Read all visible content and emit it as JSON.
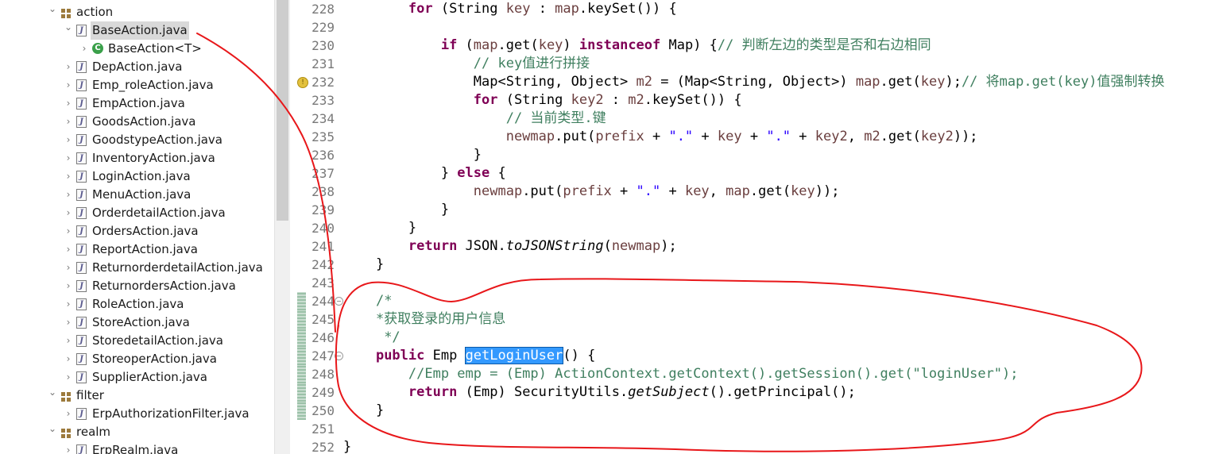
{
  "explorer": {
    "rows": [
      {
        "label": "action",
        "kind": "package",
        "expanded": true,
        "indent": 0
      },
      {
        "label": "BaseAction.java",
        "kind": "java",
        "expanded": true,
        "indent": 1,
        "selected": true
      },
      {
        "label": "BaseAction<T>",
        "kind": "class",
        "expanded": false,
        "indent": 2
      },
      {
        "label": "DepAction.java",
        "kind": "java",
        "expanded": false,
        "indent": 1
      },
      {
        "label": "Emp_roleAction.java",
        "kind": "java",
        "expanded": false,
        "indent": 1
      },
      {
        "label": "EmpAction.java",
        "kind": "java",
        "expanded": false,
        "indent": 1
      },
      {
        "label": "GoodsAction.java",
        "kind": "java",
        "expanded": false,
        "indent": 1
      },
      {
        "label": "GoodstypeAction.java",
        "kind": "java",
        "expanded": false,
        "indent": 1
      },
      {
        "label": "InventoryAction.java",
        "kind": "java",
        "expanded": false,
        "indent": 1
      },
      {
        "label": "LoginAction.java",
        "kind": "java",
        "expanded": false,
        "indent": 1
      },
      {
        "label": "MenuAction.java",
        "kind": "java",
        "expanded": false,
        "indent": 1
      },
      {
        "label": "OrderdetailAction.java",
        "kind": "java",
        "expanded": false,
        "indent": 1
      },
      {
        "label": "OrdersAction.java",
        "kind": "java",
        "expanded": false,
        "indent": 1
      },
      {
        "label": "ReportAction.java",
        "kind": "java",
        "expanded": false,
        "indent": 1
      },
      {
        "label": "ReturnorderdetailAction.java",
        "kind": "java",
        "expanded": false,
        "indent": 1
      },
      {
        "label": "ReturnordersAction.java",
        "kind": "java",
        "expanded": false,
        "indent": 1
      },
      {
        "label": "RoleAction.java",
        "kind": "java",
        "expanded": false,
        "indent": 1
      },
      {
        "label": "StoreAction.java",
        "kind": "java",
        "expanded": false,
        "indent": 1
      },
      {
        "label": "StoredetailAction.java",
        "kind": "java",
        "expanded": false,
        "indent": 1
      },
      {
        "label": "StoreoperAction.java",
        "kind": "java",
        "expanded": false,
        "indent": 1
      },
      {
        "label": "SupplierAction.java",
        "kind": "java",
        "expanded": false,
        "indent": 1
      },
      {
        "label": "filter",
        "kind": "package",
        "expanded": true,
        "indent": 0
      },
      {
        "label": "ErpAuthorizationFilter.java",
        "kind": "java",
        "expanded": false,
        "indent": 1
      },
      {
        "label": "realm",
        "kind": "package",
        "expanded": true,
        "indent": 0
      },
      {
        "label": "ErpRealm.java",
        "kind": "java",
        "expanded": false,
        "indent": 1
      }
    ]
  },
  "editor": {
    "lines": [
      {
        "num": "228",
        "tokens": [
          [
            "        ",
            ""
          ],
          [
            "for",
            "kw"
          ],
          [
            " (String ",
            ""
          ],
          [
            "key",
            "var"
          ],
          [
            " : ",
            ""
          ],
          [
            "map",
            "var"
          ],
          [
            ".keySet()) {",
            ""
          ]
        ]
      },
      {
        "num": "229",
        "tokens": []
      },
      {
        "num": "230",
        "tokens": [
          [
            "            ",
            ""
          ],
          [
            "if",
            "kw"
          ],
          [
            " (",
            ""
          ],
          [
            "map",
            "var"
          ],
          [
            ".get(",
            ""
          ],
          [
            "key",
            "var"
          ],
          [
            ") ",
            ""
          ],
          [
            "instanceof",
            "kw"
          ],
          [
            " Map) {",
            ""
          ],
          [
            "// 判断左边的类型是否和右边相同",
            "cm"
          ]
        ]
      },
      {
        "num": "231",
        "tokens": [
          [
            "                ",
            ""
          ],
          [
            "// key值进行拼接",
            "cm"
          ]
        ]
      },
      {
        "num": "232",
        "warn": true,
        "tokens": [
          [
            "                Map<String, Object> ",
            ""
          ],
          [
            "m2",
            "var"
          ],
          [
            " = (Map<String, Object>) ",
            ""
          ],
          [
            "map",
            "var"
          ],
          [
            ".get(",
            ""
          ],
          [
            "key",
            "var"
          ],
          [
            ");",
            ""
          ],
          [
            "// 将map.get(key)值强制转换",
            "cm"
          ]
        ]
      },
      {
        "num": "233",
        "tokens": [
          [
            "                ",
            ""
          ],
          [
            "for",
            "kw"
          ],
          [
            " (String ",
            ""
          ],
          [
            "key2",
            "var"
          ],
          [
            " : ",
            ""
          ],
          [
            "m2",
            "var"
          ],
          [
            ".keySet()) {",
            ""
          ]
        ]
      },
      {
        "num": "234",
        "tokens": [
          [
            "                    ",
            ""
          ],
          [
            "// 当前类型.键",
            "cm"
          ]
        ]
      },
      {
        "num": "235",
        "tokens": [
          [
            "                    ",
            ""
          ],
          [
            "newmap",
            "var"
          ],
          [
            ".put(",
            ""
          ],
          [
            "prefix",
            "var"
          ],
          [
            " + ",
            ""
          ],
          [
            "\".\"",
            "str"
          ],
          [
            " + ",
            ""
          ],
          [
            "key",
            "var"
          ],
          [
            " + ",
            ""
          ],
          [
            "\".\"",
            "str"
          ],
          [
            " + ",
            ""
          ],
          [
            "key2",
            "var"
          ],
          [
            ", ",
            ""
          ],
          [
            "m2",
            "var"
          ],
          [
            ".get(",
            ""
          ],
          [
            "key2",
            "var"
          ],
          [
            "));",
            ""
          ]
        ]
      },
      {
        "num": "236",
        "tokens": [
          [
            "                }",
            ""
          ]
        ]
      },
      {
        "num": "237",
        "tokens": [
          [
            "            } ",
            ""
          ],
          [
            "else",
            "kw"
          ],
          [
            " {",
            ""
          ]
        ]
      },
      {
        "num": "238",
        "tokens": [
          [
            "                ",
            ""
          ],
          [
            "newmap",
            "var"
          ],
          [
            ".put(",
            ""
          ],
          [
            "prefix",
            "var"
          ],
          [
            " + ",
            ""
          ],
          [
            "\".\"",
            "str"
          ],
          [
            " + ",
            ""
          ],
          [
            "key",
            "var"
          ],
          [
            ", ",
            ""
          ],
          [
            "map",
            "var"
          ],
          [
            ".get(",
            ""
          ],
          [
            "key",
            "var"
          ],
          [
            "));",
            ""
          ]
        ]
      },
      {
        "num": "239",
        "tokens": [
          [
            "            }",
            ""
          ]
        ]
      },
      {
        "num": "240",
        "tokens": [
          [
            "        }",
            ""
          ]
        ]
      },
      {
        "num": "241",
        "tokens": [
          [
            "        ",
            ""
          ],
          [
            "return",
            "kw"
          ],
          [
            " JSON.",
            ""
          ],
          [
            "toJSONString",
            "it"
          ],
          [
            "(",
            ""
          ],
          [
            "newmap",
            "var"
          ],
          [
            ");",
            ""
          ]
        ]
      },
      {
        "num": "242",
        "tokens": [
          [
            "    }",
            ""
          ]
        ]
      },
      {
        "num": "243",
        "tokens": []
      },
      {
        "num": "244",
        "changed": true,
        "fold": true,
        "tokens": [
          [
            "    ",
            ""
          ],
          [
            "/*",
            "cm"
          ]
        ]
      },
      {
        "num": "245",
        "changed": true,
        "tokens": [
          [
            "    ",
            ""
          ],
          [
            "*获取登录的用户信息",
            "cm"
          ]
        ]
      },
      {
        "num": "246",
        "changed": true,
        "tokens": [
          [
            "     ",
            ""
          ],
          [
            "*/",
            "cm"
          ]
        ]
      },
      {
        "num": "247",
        "changed": true,
        "fold": true,
        "tokens": [
          [
            "    ",
            ""
          ],
          [
            "public",
            "kw"
          ],
          [
            " Emp ",
            ""
          ],
          [
            "getLoginUser",
            "sel"
          ],
          [
            "() {",
            ""
          ]
        ]
      },
      {
        "num": "248",
        "changed": true,
        "tokens": [
          [
            "        ",
            ""
          ],
          [
            "//Emp emp = (Emp) ActionContext.getContext().getSession().get(\"loginUser\");",
            "cm"
          ]
        ]
      },
      {
        "num": "249",
        "changed": true,
        "tokens": [
          [
            "        ",
            ""
          ],
          [
            "return",
            "kw"
          ],
          [
            " (Emp) SecurityUtils.",
            ""
          ],
          [
            "getSubject",
            "it"
          ],
          [
            "().getPrincipal();",
            ""
          ]
        ]
      },
      {
        "num": "250",
        "changed": true,
        "tokens": [
          [
            "    }",
            ""
          ]
        ]
      },
      {
        "num": "251",
        "tokens": []
      },
      {
        "num": "252",
        "tokens": [
          [
            "}",
            ""
          ]
        ]
      }
    ]
  },
  "annotation": {
    "stroke_color": "#e8171a"
  }
}
